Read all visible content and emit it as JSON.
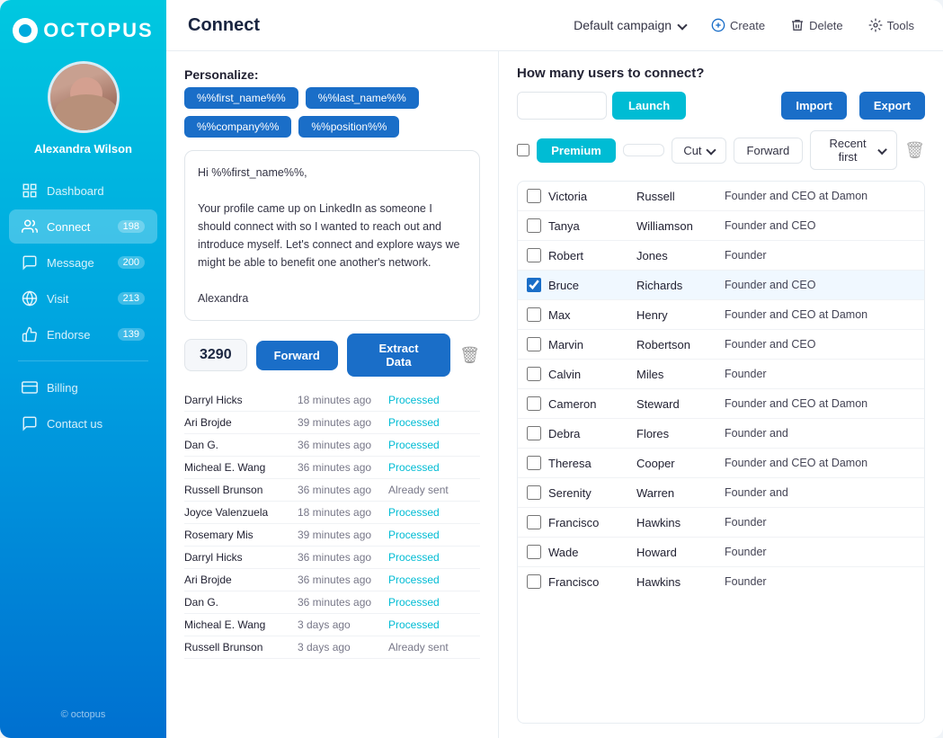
{
  "logo": {
    "text": "OCTOPUS"
  },
  "user": {
    "name": "Alexandra Wilson"
  },
  "nav": {
    "items": [
      {
        "id": "dashboard",
        "label": "Dashboard",
        "badge": null,
        "active": false
      },
      {
        "id": "connect",
        "label": "Connect",
        "badge": "198",
        "active": true
      },
      {
        "id": "message",
        "label": "Message",
        "badge": "200",
        "active": false
      },
      {
        "id": "visit",
        "label": "Visit",
        "badge": "213",
        "active": false
      },
      {
        "id": "endorse",
        "label": "Endorse",
        "badge": "139",
        "active": false
      }
    ],
    "bottom": [
      {
        "id": "billing",
        "label": "Billing",
        "badge": null
      },
      {
        "id": "contact",
        "label": "Contact us",
        "badge": null
      }
    ],
    "footer": "© octopus"
  },
  "topbar": {
    "title": "Connect",
    "campaign": "Default campaign",
    "actions": [
      "Create",
      "Delete",
      "Tools"
    ]
  },
  "left_panel": {
    "personalize_label": "Personalize:",
    "tags": [
      "%%first_name%%",
      "%%last_name%%",
      "%%company%%",
      "%%position%%"
    ],
    "message": "Hi %%first_name%%,\n\nYour profile came up on LinkedIn as someone I should connect with so I wanted to reach out and introduce myself. Let's connect and explore ways we might be able to benefit one another's network.\n\nAlexandra",
    "count": "3290",
    "forward_label": "Forward",
    "extract_label": "Extract Data",
    "log_items": [
      {
        "name": "Darryl Hicks",
        "time": "18 minutes ago",
        "status": "Processed",
        "processed": true
      },
      {
        "name": "Ari Brojde",
        "time": "39 minutes ago",
        "status": "Processed",
        "processed": true
      },
      {
        "name": "Dan G.",
        "time": "36 minutes ago",
        "status": "Processed",
        "processed": true
      },
      {
        "name": "Micheal E. Wang",
        "time": "36 minutes ago",
        "status": "Processed",
        "processed": true
      },
      {
        "name": "Russell Brunson",
        "time": "36 minutes ago",
        "status": "Already sent",
        "processed": false
      },
      {
        "name": "Joyce Valenzuela",
        "time": "18 minutes ago",
        "status": "Processed",
        "processed": true
      },
      {
        "name": "Rosemary Mis",
        "time": "39 minutes ago",
        "status": "Processed",
        "processed": true
      },
      {
        "name": "Darryl Hicks",
        "time": "36 minutes ago",
        "status": "Processed",
        "processed": true
      },
      {
        "name": "Ari Brojde",
        "time": "36 minutes ago",
        "status": "Processed",
        "processed": true
      },
      {
        "name": "Dan G.",
        "time": "36 minutes ago",
        "status": "Processed",
        "processed": true
      },
      {
        "name": "Micheal E. Wang",
        "time": "3 days ago",
        "status": "Processed",
        "processed": true
      },
      {
        "name": "Russell Brunson",
        "time": "3 days ago",
        "status": "Already sent",
        "processed": false
      }
    ]
  },
  "right_panel": {
    "header": "How many users to connect?",
    "input_placeholder": "",
    "launch_label": "Launch",
    "import_label": "Import",
    "export_label": "Export",
    "filter_premium": "Premium",
    "filter_cut": "Cut",
    "filter_forward": "Forward",
    "filter_recent": "Recent first",
    "users": [
      {
        "first": "Victoria",
        "last": "Russell",
        "title": "Founder and CEO at Damon",
        "checked": false
      },
      {
        "first": "Tanya",
        "last": "Williamson",
        "title": "Founder and CEO",
        "checked": false
      },
      {
        "first": "Robert",
        "last": "Jones",
        "title": "Founder",
        "checked": false
      },
      {
        "first": "Bruce",
        "last": "Richards",
        "title": "Founder and CEO",
        "checked": true
      },
      {
        "first": "Max",
        "last": "Henry",
        "title": "Founder and CEO at Damon",
        "checked": false
      },
      {
        "first": "Marvin",
        "last": "Robertson",
        "title": "Founder and CEO",
        "checked": false
      },
      {
        "first": "Calvin",
        "last": "Miles",
        "title": "Founder",
        "checked": false
      },
      {
        "first": "Cameron",
        "last": "Steward",
        "title": "Founder and CEO at Damon",
        "checked": false
      },
      {
        "first": "Debra",
        "last": "Flores",
        "title": "Founder and",
        "checked": false
      },
      {
        "first": "Theresa",
        "last": "Cooper",
        "title": "Founder and CEO at Damon",
        "checked": false
      },
      {
        "first": "Serenity",
        "last": "Warren",
        "title": "Founder and",
        "checked": false
      },
      {
        "first": "Francisco",
        "last": "Hawkins",
        "title": "Founder",
        "checked": false
      },
      {
        "first": "Wade",
        "last": "Howard",
        "title": "Founder",
        "checked": false
      },
      {
        "first": "Francisco",
        "last": "Hawkins",
        "title": "Founder",
        "checked": false
      }
    ]
  }
}
